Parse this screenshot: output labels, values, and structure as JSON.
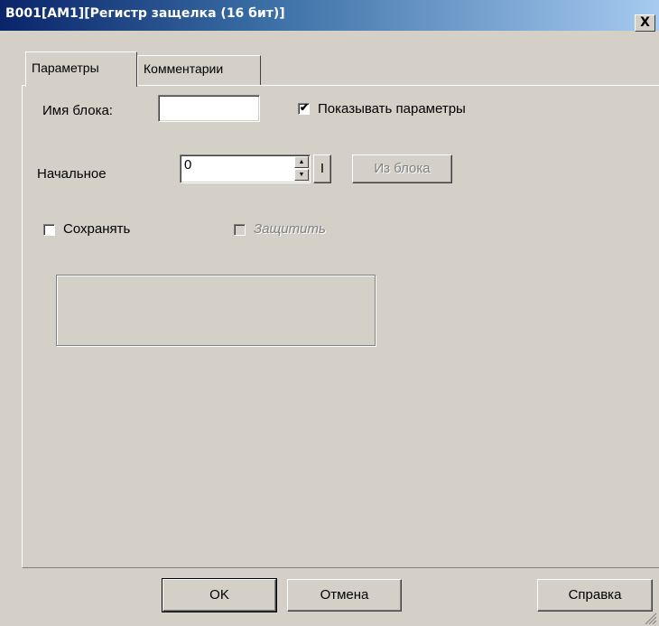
{
  "window": {
    "title": "B001[AM1][Регистр защелка (16 бит)]",
    "close_label": "X"
  },
  "tabs": [
    {
      "label": "Параметры",
      "active": true
    },
    {
      "label": "Комментарии",
      "active": false
    }
  ],
  "params": {
    "block_name_label": "Имя блока:",
    "block_name_value": "",
    "show_params_label": "Показывать параметры",
    "show_params_checked": true,
    "initial_label": "Начальное",
    "initial_value": "0",
    "initial_suffix": "I",
    "from_block_label": "Из блока",
    "save_label": "Сохранять",
    "save_checked": false,
    "protect_label": "Защитить",
    "protect_checked": false
  },
  "footer": {
    "ok_label": "OK",
    "cancel_label": "Отмена",
    "help_label": "Справка"
  },
  "icons": {
    "checkmark": "check-icon",
    "spin_up": "arrow-up-icon",
    "spin_down": "arrow-down-icon"
  }
}
